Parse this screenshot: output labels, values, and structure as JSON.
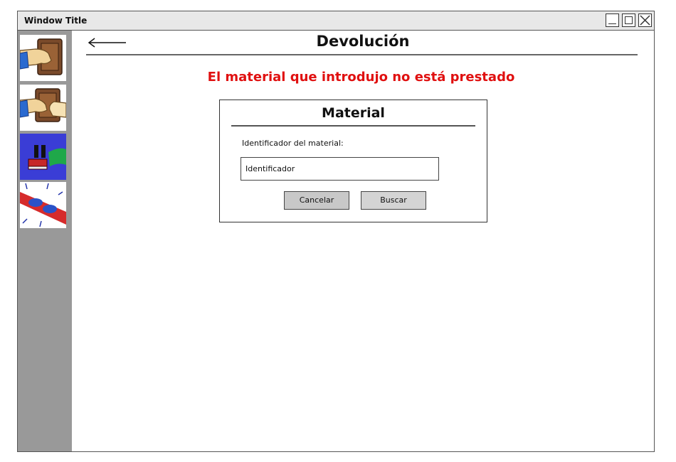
{
  "window": {
    "title": "Window Title"
  },
  "sidebar": {
    "items": [
      {
        "icon": "return-book-icon"
      },
      {
        "icon": "lend-book-icon"
      },
      {
        "icon": "pause-book-icon"
      },
      {
        "icon": "alert-siren-icon"
      }
    ]
  },
  "header": {
    "title": "Devolución"
  },
  "message": {
    "error": "El material que introdujo no está prestado"
  },
  "panel": {
    "title": "Material",
    "field_label": "Identificador del material:",
    "input_value": "Identificador",
    "cancel_label": "Cancelar",
    "search_label": "Buscar"
  },
  "colors": {
    "error": "#e01010",
    "sidebar": "#999999",
    "accent_tile": "#3a3dd6"
  }
}
